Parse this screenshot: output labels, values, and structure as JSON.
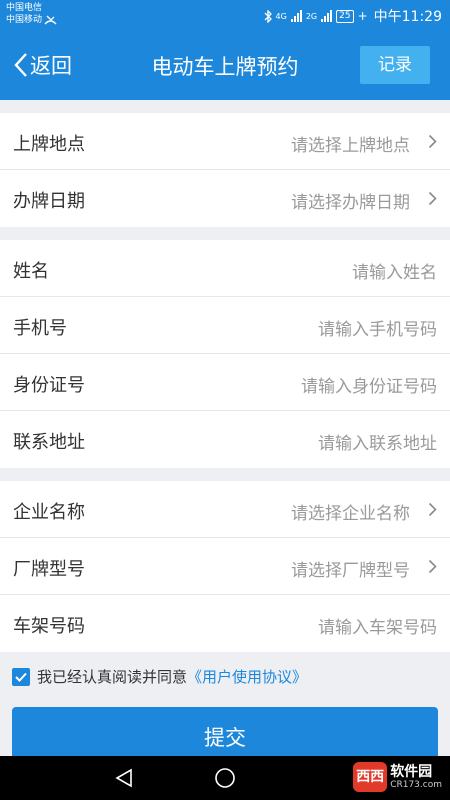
{
  "status_bar": {
    "carrier_1": "中国电信",
    "carrier_2": "中国移动",
    "network_1": "4G",
    "network_2": "2G",
    "battery": "25",
    "time": "中午11:29"
  },
  "header": {
    "back_label": "返回",
    "title": "电动车上牌预约",
    "record_label": "记录"
  },
  "groups": [
    {
      "rows": [
        {
          "label": "上牌地点",
          "placeholder": "请选择上牌地点",
          "selectable": true
        },
        {
          "label": "办牌日期",
          "placeholder": "请选择办牌日期",
          "selectable": true
        }
      ]
    },
    {
      "rows": [
        {
          "label": "姓名",
          "placeholder": "请输入姓名",
          "selectable": false
        },
        {
          "label": "手机号",
          "placeholder": "请输入手机号码",
          "selectable": false
        },
        {
          "label": "身份证号",
          "placeholder": "请输入身份证号码",
          "selectable": false
        },
        {
          "label": "联系地址",
          "placeholder": "请输入联系地址",
          "selectable": false
        }
      ]
    },
    {
      "rows": [
        {
          "label": "企业名称",
          "placeholder": "请选择企业名称",
          "selectable": true
        },
        {
          "label": "厂牌型号",
          "placeholder": "请选择厂牌型号",
          "selectable": true
        },
        {
          "label": "车架号码",
          "placeholder": "请输入车架号码",
          "selectable": false
        }
      ]
    }
  ],
  "agreement": {
    "checked": true,
    "text": "我已经认真阅读并同意",
    "link": "《用户使用协议》"
  },
  "submit_label": "提交",
  "watermark": {
    "badge": "西西",
    "text": "软件园",
    "sub": "CR173.com"
  },
  "colors": {
    "primary": "#1d88db",
    "record_button": "#43b1f0",
    "background": "#eeeff3",
    "placeholder": "#9a9a9a"
  }
}
